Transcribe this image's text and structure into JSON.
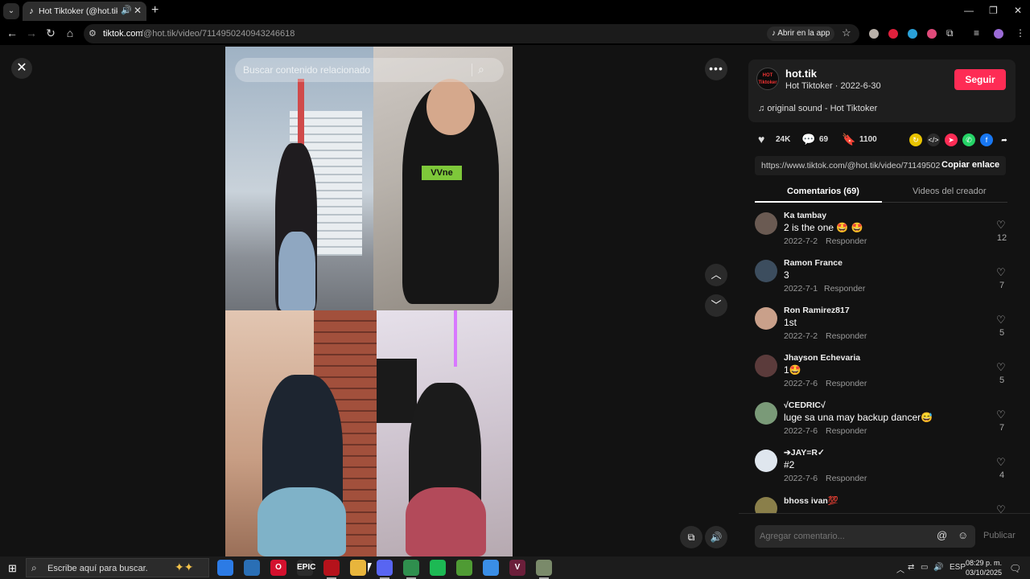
{
  "browser": {
    "tab_title": "Hot Tiktoker (@hot.tik) | Tik",
    "url_host": "tiktok.com",
    "url_path": "/@hot.tik/video/7114950240943246618",
    "open_in_app": "Abrir en la app"
  },
  "video": {
    "related_search_placeholder": "Buscar contenido relacionado",
    "shirt_text": "VVne"
  },
  "post": {
    "avatar_text": "HOT Tiktoker",
    "username": "hot.tik",
    "nickname_date": "Hot Tiktoker · 2022-6-30",
    "follow_label": "Seguir",
    "music": "original sound - Hot Tiktoker",
    "likes": "24K",
    "comments": "69",
    "saves": "1100",
    "link": "https://www.tiktok.com/@hot.tik/video/71149502...",
    "copy_link_label": "Copiar enlace",
    "tab_comments": "Comentarios (69)",
    "tab_creator_videos": "Videos del creador"
  },
  "comments": [
    {
      "user": "Ka tambay",
      "text": "2 is the one 🤩 🤩",
      "date": "2022-7-2",
      "reply": "Responder",
      "likes": "12",
      "avatar_color": "#6a5a52"
    },
    {
      "user": "Ramon France",
      "text": "3",
      "date": "2022-7-1",
      "reply": "Responder",
      "likes": "7",
      "avatar_color": "#3c4d5e"
    },
    {
      "user": "Ron Ramirez817",
      "text": "1st",
      "date": "2022-7-2",
      "reply": "Responder",
      "likes": "5",
      "avatar_color": "#c9a08a"
    },
    {
      "user": "Jhayson Echevaria",
      "text": "1🤩",
      "date": "2022-7-6",
      "reply": "Responder",
      "likes": "5",
      "avatar_color": "#5b3b3b"
    },
    {
      "user": "√CEDRIC√",
      "text": "luge sa una may backup dancer😅",
      "date": "2022-7-6",
      "reply": "Responder",
      "likes": "7",
      "avatar_color": "#7a9a78"
    },
    {
      "user": "➔JAY=R✓",
      "text": "#2",
      "date": "2022-7-6",
      "reply": "Responder",
      "likes": "4",
      "avatar_color": "#dfe6ee"
    },
    {
      "user": "bhoss ivan💯",
      "text": "",
      "date": "",
      "reply": "",
      "likes": "",
      "avatar_color": "#8a7f4a"
    }
  ],
  "comment_box": {
    "placeholder": "Agregar comentario...",
    "publish_label": "Publicar"
  },
  "taskbar": {
    "search_placeholder": "Escribe aquí para buscar.",
    "lang": "ESP",
    "time": "08:29 p. m.",
    "date": "03/10/2025",
    "apps": [
      {
        "name": "copilot-app",
        "label": "",
        "color": "#2c7be5"
      },
      {
        "name": "store-app",
        "label": "",
        "color": "#2a6fb5"
      },
      {
        "name": "opera-app",
        "label": "O",
        "color": "#d3112e"
      },
      {
        "name": "epic-games-app",
        "label": "EPIC",
        "color": "#2b2b2b"
      },
      {
        "name": "xsplit-app",
        "label": "",
        "color": "#b5121b"
      },
      {
        "name": "file-explorer-app",
        "label": "",
        "color": "#e8b53c"
      },
      {
        "name": "discord-app",
        "label": "",
        "color": "#5865f2"
      },
      {
        "name": "chrome-app",
        "label": "",
        "color": "#2f8f4e"
      },
      {
        "name": "spotify-app",
        "label": "",
        "color": "#1db954"
      },
      {
        "name": "minecraft-app",
        "label": "",
        "color": "#4f9b34"
      },
      {
        "name": "messenger-app",
        "label": "",
        "color": "#3a8ee6"
      },
      {
        "name": "vegas-app",
        "label": "V",
        "color": "#6b1f3a"
      },
      {
        "name": "photos-app",
        "label": "",
        "color": "#7a8a6a"
      }
    ]
  }
}
